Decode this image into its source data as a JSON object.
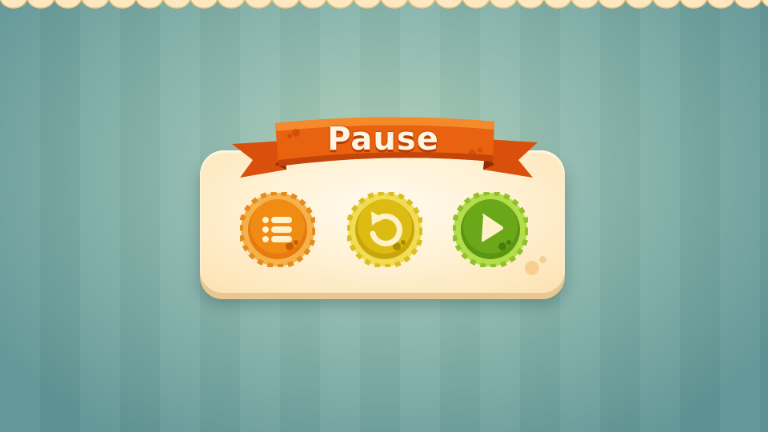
{
  "dialog": {
    "title": "Pause"
  },
  "buttons": [
    {
      "id": "menu",
      "icon": "list-menu-icon",
      "color": "#e87d0e"
    },
    {
      "id": "restart",
      "icon": "restart-arrow-icon",
      "color": "#d8b412"
    },
    {
      "id": "resume",
      "icon": "play-triangle-icon",
      "color": "#6aa819"
    }
  ],
  "colors": {
    "ribbon": "#e0560f",
    "panel": "#fff1d3",
    "background": "#8cb8ae"
  }
}
